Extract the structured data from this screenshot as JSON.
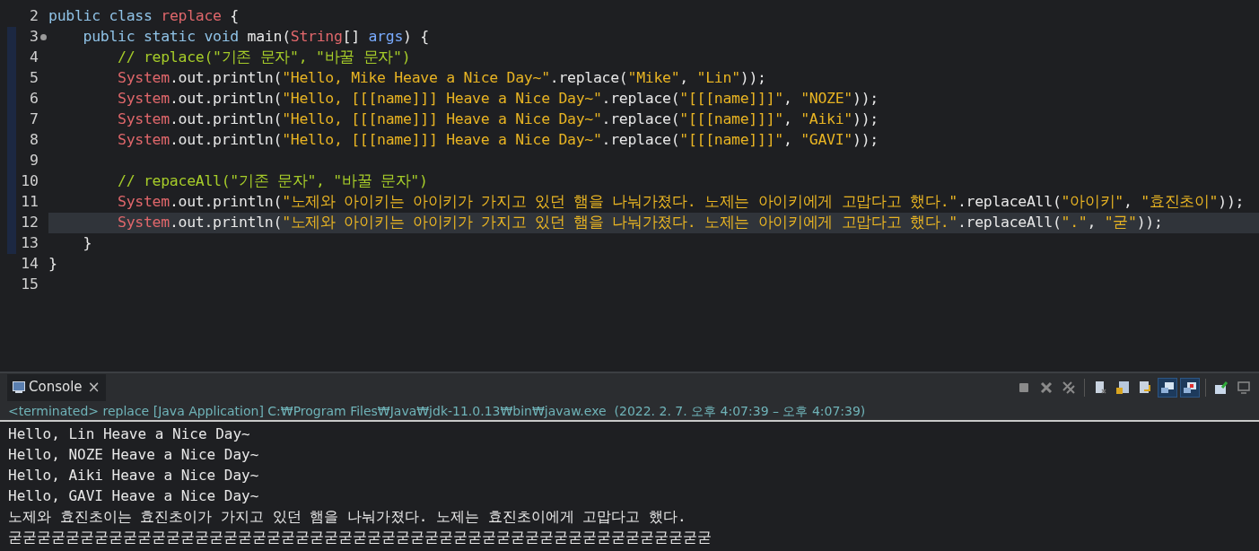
{
  "editor": {
    "lines": [
      {
        "number": "2",
        "current": false,
        "tokens": [
          {
            "kind": "keyword",
            "text": "public class "
          },
          {
            "kind": "type",
            "text": "replace"
          },
          {
            "kind": "plain",
            "text": " {"
          }
        ]
      },
      {
        "number": "3",
        "current": false,
        "fold": true,
        "tokens": [
          {
            "kind": "keyword",
            "text": "    public static void "
          },
          {
            "kind": "plain",
            "text": "main("
          },
          {
            "kind": "type",
            "text": "String"
          },
          {
            "kind": "plain",
            "text": "[] "
          },
          {
            "kind": "param",
            "text": "args"
          },
          {
            "kind": "plain",
            "text": ") {"
          }
        ]
      },
      {
        "number": "4",
        "current": false,
        "tokens": [
          {
            "kind": "comment",
            "text": "        // replace(\"기존 문자\", \"바꿀 문자\")"
          }
        ]
      },
      {
        "number": "5",
        "current": false,
        "tokens": [
          {
            "kind": "type",
            "text": "        System"
          },
          {
            "kind": "plain",
            "text": ".out.println("
          },
          {
            "kind": "string",
            "text": "\"Hello, Mike Heave a Nice Day~\""
          },
          {
            "kind": "plain",
            "text": ".replace("
          },
          {
            "kind": "string",
            "text": "\"Mike\""
          },
          {
            "kind": "plain",
            "text": ", "
          },
          {
            "kind": "string",
            "text": "\"Lin\""
          },
          {
            "kind": "plain",
            "text": "));"
          }
        ]
      },
      {
        "number": "6",
        "current": false,
        "tokens": [
          {
            "kind": "type",
            "text": "        System"
          },
          {
            "kind": "plain",
            "text": ".out.println("
          },
          {
            "kind": "string",
            "text": "\"Hello, [[[name]]] Heave a Nice Day~\""
          },
          {
            "kind": "plain",
            "text": ".replace("
          },
          {
            "kind": "string",
            "text": "\"[[[name]]]\""
          },
          {
            "kind": "plain",
            "text": ", "
          },
          {
            "kind": "string",
            "text": "\"NOZE\""
          },
          {
            "kind": "plain",
            "text": "));"
          }
        ]
      },
      {
        "number": "7",
        "current": false,
        "tokens": [
          {
            "kind": "type",
            "text": "        System"
          },
          {
            "kind": "plain",
            "text": ".out.println("
          },
          {
            "kind": "string",
            "text": "\"Hello, [[[name]]] Heave a Nice Day~\""
          },
          {
            "kind": "plain",
            "text": ".replace("
          },
          {
            "kind": "string",
            "text": "\"[[[name]]]\""
          },
          {
            "kind": "plain",
            "text": ", "
          },
          {
            "kind": "string",
            "text": "\"Aiki\""
          },
          {
            "kind": "plain",
            "text": "));"
          }
        ]
      },
      {
        "number": "8",
        "current": false,
        "tokens": [
          {
            "kind": "type",
            "text": "        System"
          },
          {
            "kind": "plain",
            "text": ".out.println("
          },
          {
            "kind": "string",
            "text": "\"Hello, [[[name]]] Heave a Nice Day~\""
          },
          {
            "kind": "plain",
            "text": ".replace("
          },
          {
            "kind": "string",
            "text": "\"[[[name]]]\""
          },
          {
            "kind": "plain",
            "text": ", "
          },
          {
            "kind": "string",
            "text": "\"GAVI\""
          },
          {
            "kind": "plain",
            "text": "));"
          }
        ]
      },
      {
        "number": "9",
        "current": false
      },
      {
        "number": "10",
        "current": false,
        "tokens": [
          {
            "kind": "comment",
            "text": "        // repaceAll(\"기존 문자\", \"바꿀 문자\")"
          }
        ]
      },
      {
        "number": "11",
        "current": false,
        "tokens": [
          {
            "kind": "type",
            "text": "        System"
          },
          {
            "kind": "plain",
            "text": ".out.println("
          },
          {
            "kind": "string",
            "text": "\"노제와 아이키는 아이키가 가지고 있던 햄을 나눠가졌다. 노제는 아이키에게 고맙다고 했다.\""
          },
          {
            "kind": "plain",
            "text": ".replaceAll("
          },
          {
            "kind": "string",
            "text": "\"아이키\""
          },
          {
            "kind": "plain",
            "text": ", "
          },
          {
            "kind": "string",
            "text": "\"효진초이\""
          },
          {
            "kind": "plain",
            "text": "));"
          }
        ]
      },
      {
        "number": "12",
        "current": true,
        "tokens": [
          {
            "kind": "type",
            "text": "        System"
          },
          {
            "kind": "plain",
            "text": ".out.println("
          },
          {
            "kind": "string",
            "text": "\"노제와 아이키는 아이키가 가지고 있던 햄을 나눠가졌다. 노제는 아이키에게 고맙다고 했다.\""
          },
          {
            "kind": "plain",
            "text": ".replaceAll("
          },
          {
            "kind": "string",
            "text": "\".\""
          },
          {
            "kind": "plain",
            "text": ", "
          },
          {
            "kind": "string",
            "text": "\"굳\""
          },
          {
            "kind": "plain",
            "text": "));"
          }
        ]
      },
      {
        "number": "13",
        "current": false,
        "tokens": [
          {
            "kind": "plain",
            "text": "    }"
          }
        ]
      },
      {
        "number": "14",
        "current": false,
        "tokens": [
          {
            "kind": "plain",
            "text": "}"
          }
        ]
      },
      {
        "number": "15",
        "current": false
      }
    ]
  },
  "console": {
    "tab": {
      "label": "Console",
      "close": "×"
    },
    "toolbar": [
      {
        "kind": "stop",
        "pressed": false
      },
      {
        "kind": "remove",
        "pressed": false
      },
      {
        "kind": "remove-all",
        "pressed": false
      },
      {
        "kind": "page",
        "pressed": false
      },
      {
        "kind": "lock",
        "pressed": false
      },
      {
        "kind": "wrap",
        "pressed": false
      },
      {
        "kind": "show-out",
        "pressed": true
      },
      {
        "kind": "show-err",
        "pressed": true
      },
      {
        "kind": "pin",
        "pressed": false
      },
      {
        "kind": "display",
        "pressed": false
      }
    ],
    "status": "<terminated> replace [Java Application] C:₩Program Files₩Java₩jdk-11.0.13₩bin₩javaw.exe  (2022. 2. 7. 오후 4:07:39 – 오후 4:07:39)",
    "output": [
      "Hello, Lin Heave a Nice Day~",
      "Hello, NOZE Heave a Nice Day~",
      "Hello, Aiki Heave a Nice Day~",
      "Hello, GAVI Heave a Nice Day~",
      "노제와 효진초이는 효진초이가 가지고 있던 햄을 나눠가졌다. 노제는 효진초이에게 고맙다고 했다.",
      "굳굳굳굳굳굳굳굳굳굳굳굳굳굳굳굳굳굳굳굳굳굳굳굳굳굳굳굳굳굳굳굳굳굳굳굳굳굳굳굳굳굳굳굳굳굳굳굳굳"
    ]
  }
}
